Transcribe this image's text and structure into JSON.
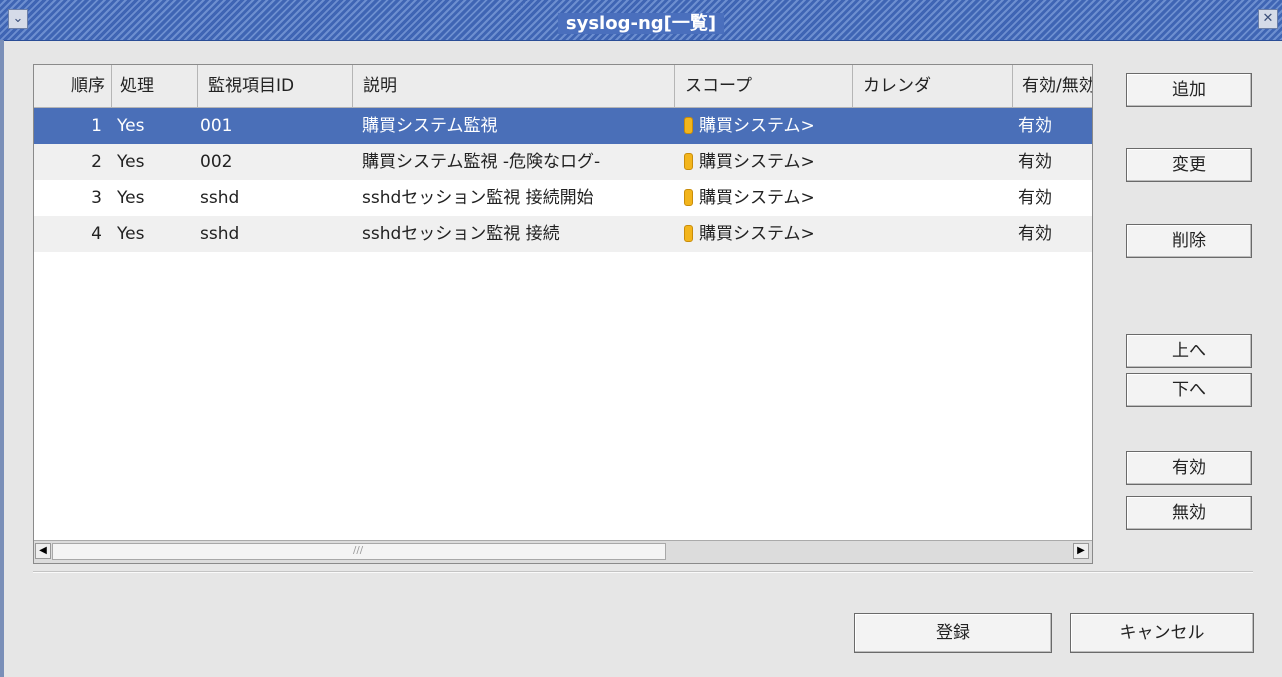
{
  "window": {
    "title": "syslog-ng[一覧]",
    "menu_icon": "chevron-down-icon",
    "close_icon": "close-icon"
  },
  "table": {
    "columns": [
      "順序",
      "処理",
      "監視項目ID",
      "説明",
      "スコープ",
      "カレンダ",
      "有効/無効"
    ],
    "rows": [
      {
        "order": "1",
        "process": "Yes",
        "monitor_id": "001",
        "description": "購買システム監視",
        "scope": "購買システム>",
        "calendar": "",
        "enabled": "有効"
      },
      {
        "order": "2",
        "process": "Yes",
        "monitor_id": "002",
        "description": "購買システム監視 -危険なログ-",
        "scope": "購買システム>",
        "calendar": "",
        "enabled": "有効"
      },
      {
        "order": "3",
        "process": "Yes",
        "monitor_id": "sshd",
        "description": "sshdセッション監視 接続開始",
        "scope": "購買システム>",
        "calendar": "",
        "enabled": "有効"
      },
      {
        "order": "4",
        "process": "Yes",
        "monitor_id": "sshd",
        "description": "sshdセッション監視 接続",
        "scope": "購買システム>",
        "calendar": "",
        "enabled": "有効"
      }
    ],
    "selected_row": 1,
    "scope_icon": "scope-folder-icon",
    "hscroll_left_icon": "arrow-left-icon",
    "hscroll_right_icon": "arrow-right-icon"
  },
  "side_buttons": {
    "add": "追加",
    "change": "変更",
    "delete": "削除",
    "up": "上へ",
    "down": "下へ",
    "enable": "有効",
    "disable": "無効"
  },
  "footer": {
    "register": "登録",
    "cancel": "キャンセル"
  },
  "colors": {
    "selection": "#4a6fb8",
    "titlebar": "#3f65b4",
    "scope_icon": "#f3b51c"
  }
}
